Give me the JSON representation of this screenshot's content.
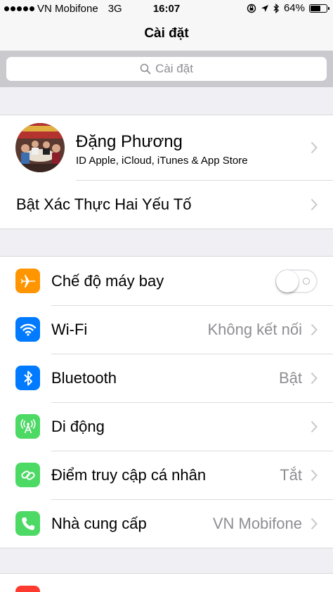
{
  "status_bar": {
    "carrier": "VN Mobifone",
    "network": "3G",
    "time": "16:07",
    "battery_percent": "64%",
    "battery_level": 0.64
  },
  "nav": {
    "title": "Cài đặt"
  },
  "search": {
    "placeholder": "Cài đặt"
  },
  "profile": {
    "name": "Đặng Phương",
    "subtitle": "ID Apple, iCloud, iTunes & App Store"
  },
  "two_factor": {
    "label": "Bật Xác Thực Hai Yếu Tố"
  },
  "settings": [
    {
      "label": "Chế độ máy bay",
      "value": "",
      "icon": "airplane-icon",
      "color": "#ff9500",
      "toggle": false
    },
    {
      "label": "Wi-Fi",
      "value": "Không kết nối",
      "icon": "wifi-icon",
      "color": "#007aff"
    },
    {
      "label": "Bluetooth",
      "value": "Bật",
      "icon": "bluetooth-icon",
      "color": "#007aff"
    },
    {
      "label": "Di động",
      "value": "",
      "icon": "cellular-icon",
      "color": "#4cd964"
    },
    {
      "label": "Điểm truy cập cá nhân",
      "value": "Tắt",
      "icon": "hotspot-icon",
      "color": "#4cd964"
    },
    {
      "label": "Nhà cung cấp",
      "value": "VN Mobifone",
      "icon": "phone-icon",
      "color": "#4cd964"
    }
  ]
}
